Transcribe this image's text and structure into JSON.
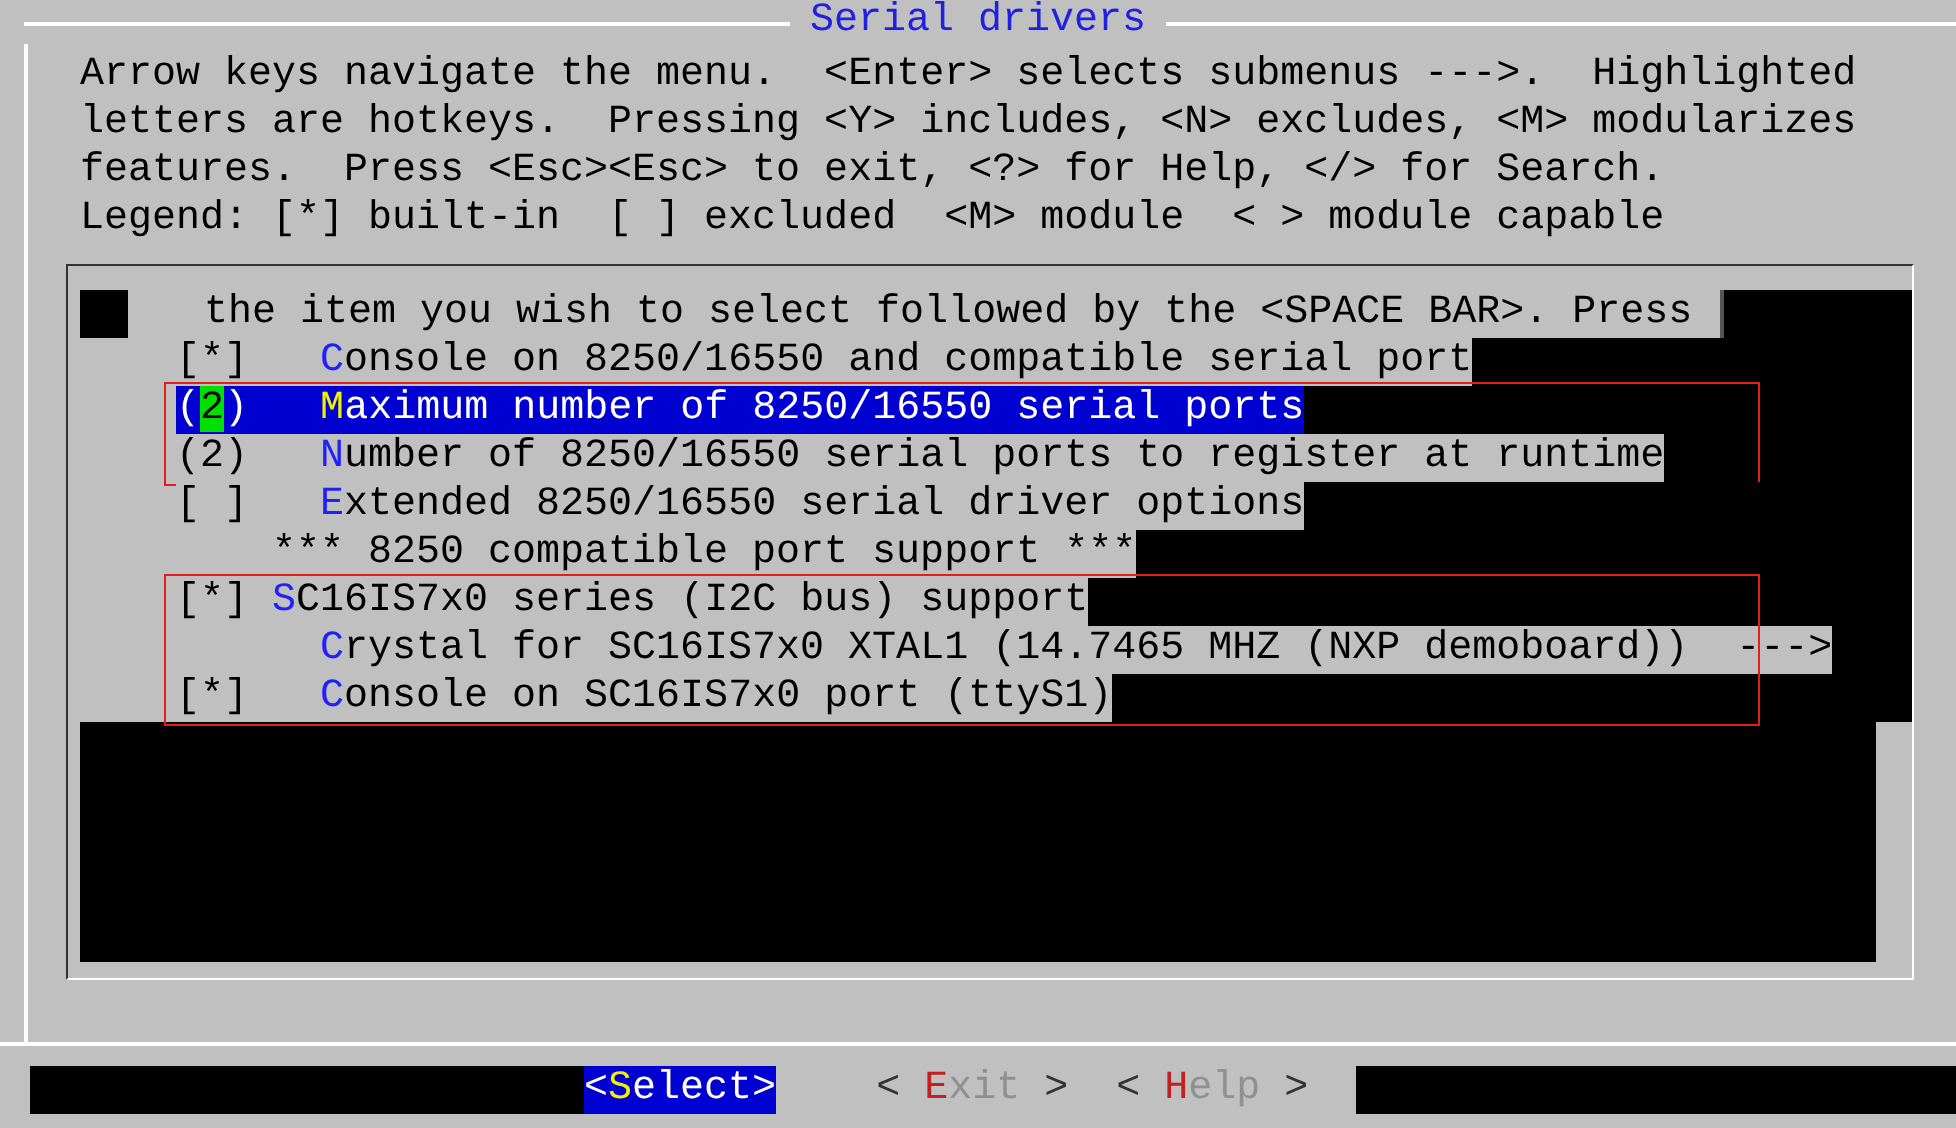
{
  "window": {
    "title": "Serial drivers"
  },
  "help_lines": [
    "Arrow keys navigate the menu.  <Enter> selects submenus --->.  Highlighted",
    "letters are hotkeys.  Pressing <Y> includes, <N> excludes, <M> modularizes",
    "features.  Press <Esc><Esc> to exit, <?> for Help, </> for Search.",
    "Legend: [*] built-in  [ ] excluded  <M> module  < > module capable"
  ],
  "menu": {
    "header_text": "the item you wish to select followed by the <SPACE BAR>. Press",
    "groups": [
      {
        "items": [
          {
            "kind": "option",
            "selected": false,
            "before": "[*]   ",
            "hotkey": "C",
            "after": "onsole on 8250/16550 and compatible serial port"
          }
        ]
      },
      {
        "framed": true,
        "items": [
          {
            "kind": "option",
            "selected": true,
            "before": "(2)   ",
            "hotkey": "M",
            "after": "aximum number of 8250/16550 serial ports"
          },
          {
            "kind": "option",
            "selected": false,
            "before": "(2)   ",
            "hotkey": "N",
            "after": "umber of 8250/16550 serial ports to register at runtime"
          }
        ]
      },
      {
        "items": [
          {
            "kind": "option",
            "selected": false,
            "before": "[ ]   ",
            "hotkey": "E",
            "after": "xtended 8250/16550 serial driver options"
          },
          {
            "kind": "comment",
            "selected": false,
            "text": "    *** 8250 compatible port support ***"
          }
        ]
      },
      {
        "framed": true,
        "items": [
          {
            "kind": "option",
            "selected": false,
            "before": "[*] ",
            "hotkey": "S",
            "after": "C16IS7x0 series (I2C bus) support"
          },
          {
            "kind": "option",
            "selected": false,
            "hotkey": "C",
            "after": "rystal for SC16IS7x0 XTAL1 (14.7465 MHZ (NXP demoboard))  --->"
          },
          {
            "kind": "option",
            "selected": false,
            "before": "[*]   ",
            "hotkey": "C",
            "after": "onsole on SC16IS7x0 port (ttyS1)"
          }
        ]
      }
    ]
  },
  "buttons": [
    {
      "left": "<",
      "hotkey": "S",
      "rest": "elect",
      "right": ">",
      "selected": true
    },
    {
      "left": "< ",
      "hotkey": "E",
      "rest": "xit",
      "right": " >",
      "selected": false
    },
    {
      "left": "< ",
      "hotkey": "H",
      "rest": "elp",
      "right": " >",
      "selected": false
    }
  ]
}
